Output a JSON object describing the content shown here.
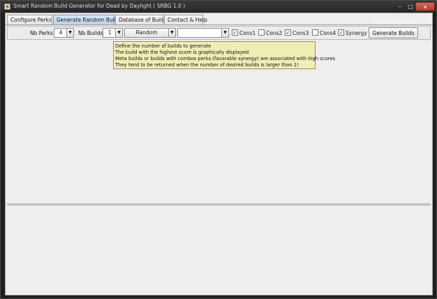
{
  "window": {
    "title": "Smart Random Build Generator for Dead by Daylight ( SRBG 1.0 )",
    "controls": {
      "minimize": "–",
      "maximize": "□",
      "close": "✕"
    }
  },
  "tabs": [
    {
      "label": "Configure Perks",
      "active": false
    },
    {
      "label": "Generate Random Builds",
      "active": true
    },
    {
      "label": "Database of Builds",
      "active": false
    },
    {
      "label": "Contact & Help",
      "active": false
    }
  ],
  "toolbar": {
    "nb_perks_label": "Nb Perks",
    "nb_perks_value": "4",
    "nb_builds_label": "Nb Builds",
    "nb_builds_value": "1",
    "mode_value": "Random",
    "filter_value": "",
    "checkboxes": [
      {
        "label": "Cons1",
        "checked": true,
        "mark": "✓"
      },
      {
        "label": "Cons2",
        "checked": false,
        "mark": ""
      },
      {
        "label": "Cons3",
        "checked": true,
        "mark": "✓"
      },
      {
        "label": "Cons4",
        "checked": false,
        "mark": ""
      },
      {
        "label": "Synergy",
        "checked": true,
        "mark": "✓"
      }
    ],
    "generate_label": "Generate Builds",
    "arrow_glyph": "▼"
  },
  "tooltip": {
    "lines": [
      "Define the number of builds to generate",
      "The build with the highest score is graphically displayed",
      "Meta builds or builds with combos perks (favorable synergy) are associated with high scores",
      "They tend to be returned when the number of desired builds is larger than 1!"
    ]
  },
  "colors": {
    "tooltip_bg": "#eeeeb5",
    "active_tab": "#b9d2e8",
    "close_button": "#c0483a"
  }
}
